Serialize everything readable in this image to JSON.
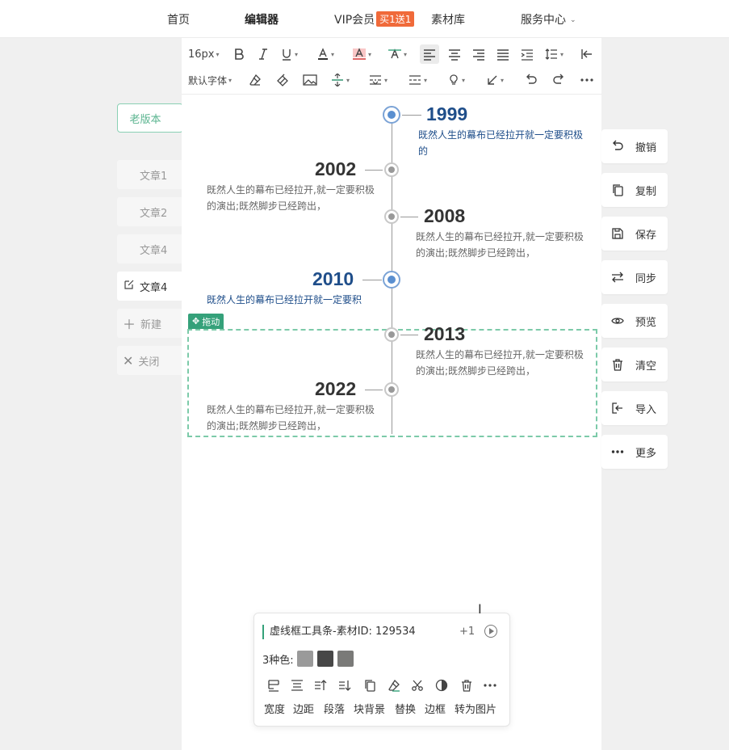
{
  "nav": {
    "home": "首页",
    "editor": "编辑器",
    "vip": "VIP会员",
    "vip_badge": "买1送1",
    "assets": "素材库",
    "service": "服务中心"
  },
  "toolbar": {
    "font_size": "16px",
    "font_family": "默认字体"
  },
  "left_panel": {
    "old_version": "老版本",
    "articles": [
      "文章1",
      "文章2",
      "文章4"
    ],
    "current_article": "文章4",
    "new": "新建",
    "close": "关闭"
  },
  "timeline": [
    {
      "year": "1999",
      "desc": "既然人生的幕布已经拉开就一定要积极的",
      "highlight": true
    },
    {
      "year": "2002",
      "desc": "既然人生的幕布已经拉开,就一定要积极的演出;既然脚步已经跨出，",
      "highlight": false
    },
    {
      "year": "2008",
      "desc": "既然人生的幕布已经拉开,就一定要积极的演出;既然脚步已经跨出，",
      "highlight": false
    },
    {
      "year": "2010",
      "desc": "既然人生的幕布已经拉开就一定要积",
      "highlight": true
    },
    {
      "year": "2013",
      "desc": "既然人生的幕布已经拉开,就一定要积极的演出;既然脚步已经跨出，",
      "highlight": false
    },
    {
      "year": "2022",
      "desc": "既然人生的幕布已经拉开,就一定要积极的演出;既然脚步已经跨出，",
      "highlight": false
    }
  ],
  "drag_label": "拖动",
  "right_panel": [
    "撤销",
    "复制",
    "保存",
    "同步",
    "预览",
    "清空",
    "导入",
    "更多"
  ],
  "material_card": {
    "title": "虚线框工具条-素材ID: 129534",
    "plus": "+1",
    "colors_label": "3种色:",
    "colors": [
      "#9a9a9a",
      "#474747",
      "#7a7a78"
    ],
    "actions": [
      "宽度",
      "边距",
      "段落",
      "块背景",
      "替换",
      "边框",
      "转为图片"
    ]
  }
}
